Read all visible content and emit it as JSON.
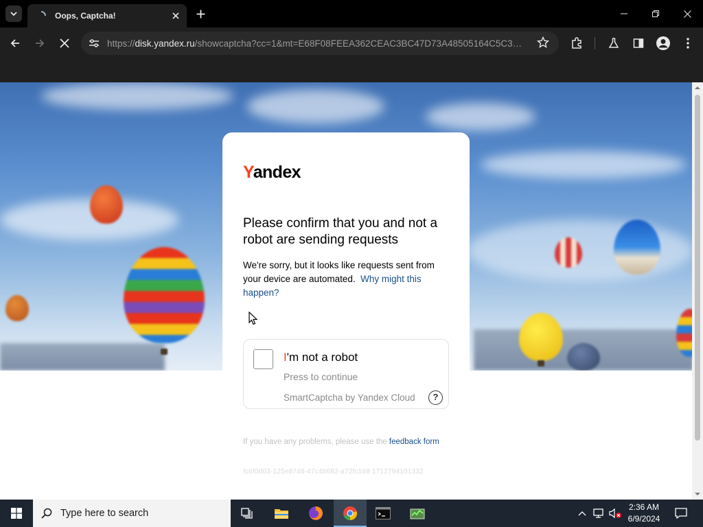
{
  "browser": {
    "tab_title": "Oops, Captcha!",
    "url_scheme": "https://",
    "url_host": "disk.yandex.ru",
    "url_rest": "/showcaptcha?cc=1&mt=E68F08FEEA362CEAC3BC47D73A48505164C5C380..."
  },
  "page": {
    "logo_first": "Y",
    "logo_rest": "andex",
    "heading": "Please confirm that you and not a robot are sending requests",
    "body": "We're sorry, but it looks like requests sent from your device are automated.",
    "why_link": "Why might this happen?",
    "captcha": {
      "label_first": "I",
      "label_rest": "'m not a robot",
      "sublabel": "Press to continue",
      "brand": "SmartCaptcha by Yandex Cloud",
      "help": "?"
    },
    "feedback_text": "If you have any problems, please use the",
    "feedback_link": "feedback form",
    "request_id": "fc6f0d03-125e8748-47c4b682-a72fc168 1712794101332"
  },
  "taskbar": {
    "search_placeholder": "Type here to search",
    "time": "2:36 AM",
    "date": "6/9/2024"
  },
  "colors": {
    "yandex_red": "#fc3f1d",
    "link_blue": "#1a4e8a",
    "taskbar_bg": "#1c2530",
    "chrome_bg": "#1f1f1f"
  }
}
